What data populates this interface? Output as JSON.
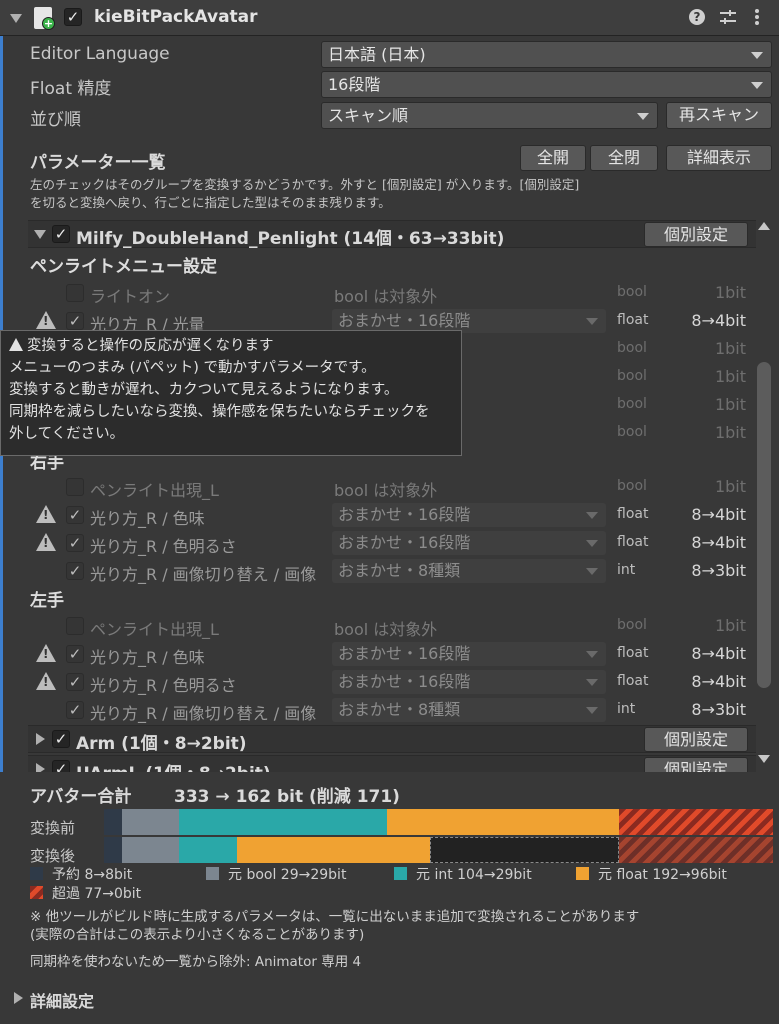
{
  "header": {
    "title": "kieBitPackAvatar",
    "enabled": true
  },
  "settings": {
    "editor_language_label": "Editor Language",
    "editor_language_value": "日本語 (日本)",
    "float_precision_label": "Float 精度",
    "float_precision_value": "16段階",
    "sort_order_label": "並び順",
    "sort_order_value": "スキャン順",
    "rescan_button": "再スキャン"
  },
  "param_list": {
    "title": "パラメーター一覧",
    "expand_all": "全開",
    "collapse_all": "全閉",
    "details_button": "詳細表示",
    "help_line1": "左のチェックはそのグループを変換するかどうかです。外すと [個別設定] が入ります。[個別設定]",
    "help_line2": "を切ると変換へ戻り、行ごとに指定した型はそのまま残ります。"
  },
  "groups": [
    {
      "title": "Milfy_DoubleHand_Penlight  (14個・63→33bit)",
      "button": "個別設定",
      "subsections": [
        {
          "title": "ペンライトメニュー設定",
          "rows": [
            {
              "name": "ライトオン",
              "mode": "bool は対象外",
              "type": "bool",
              "bits": "1bit",
              "checked": false,
              "warn": false,
              "excluded": true
            },
            {
              "name": "光り方_R / 光量",
              "mode": "おまかせ・16段階",
              "type": "float",
              "bits": "8→4bit",
              "checked": true,
              "warn": true,
              "excluded": false
            },
            {
              "name": "",
              "mode": "",
              "type": "bool",
              "bits": "1bit",
              "checked": false,
              "warn": false,
              "excluded": true
            },
            {
              "name": "",
              "mode": "",
              "type": "bool",
              "bits": "1bit",
              "checked": false,
              "warn": false,
              "excluded": true
            },
            {
              "name": "",
              "mode": "",
              "type": "bool",
              "bits": "1bit",
              "checked": false,
              "warn": false,
              "excluded": true
            },
            {
              "name": "",
              "mode": "",
              "type": "bool",
              "bits": "1bit",
              "checked": false,
              "warn": false,
              "excluded": true
            }
          ]
        },
        {
          "title": "右手",
          "rows": [
            {
              "name": "ペンライト出現_L",
              "mode": "bool は対象外",
              "type": "bool",
              "bits": "1bit",
              "checked": false,
              "warn": false,
              "excluded": true
            },
            {
              "name": "光り方_R / 色味",
              "mode": "おまかせ・16段階",
              "type": "float",
              "bits": "8→4bit",
              "checked": true,
              "warn": true,
              "excluded": false
            },
            {
              "name": "光り方_R / 色明るさ",
              "mode": "おまかせ・16段階",
              "type": "float",
              "bits": "8→4bit",
              "checked": true,
              "warn": true,
              "excluded": false
            },
            {
              "name": "光り方_R / 画像切り替え / 画像",
              "mode": "おまかせ・8種類",
              "type": "int",
              "bits": "8→3bit",
              "checked": true,
              "warn": false,
              "excluded": false
            }
          ]
        },
        {
          "title": "左手",
          "rows": [
            {
              "name": "ペンライト出現_L",
              "mode": "bool は対象外",
              "type": "bool",
              "bits": "1bit",
              "checked": false,
              "warn": false,
              "excluded": true
            },
            {
              "name": "光り方_R / 色味",
              "mode": "おまかせ・16段階",
              "type": "float",
              "bits": "8→4bit",
              "checked": true,
              "warn": true,
              "excluded": false
            },
            {
              "name": "光り方_R / 色明るさ",
              "mode": "おまかせ・16段階",
              "type": "float",
              "bits": "8→4bit",
              "checked": true,
              "warn": true,
              "excluded": false
            },
            {
              "name": "光り方_R / 画像切り替え / 画像",
              "mode": "おまかせ・8種類",
              "type": "int",
              "bits": "8→3bit",
              "checked": true,
              "warn": false,
              "excluded": false
            }
          ]
        }
      ]
    },
    {
      "title": "Arm  (1個・8→2bit)",
      "button": "個別設定"
    },
    {
      "title": "UArmL  (1個・8→2bit)",
      "button": "個別設定"
    }
  ],
  "tooltip": {
    "line1": "変換すると操作の反応が遅くなります",
    "line2": "メニューのつまみ (パペット) で動かすパラメータです。",
    "line3": "変換すると動きが遅れ、カクついて見えるようになります。",
    "line4": "同期枠を減らしたいなら変換、操作感を保ちたいならチェックを",
    "line5": "外してください。"
  },
  "summary": {
    "title": "アバター合計",
    "total": "333 → 162 bit  (削減 171)",
    "before_label": "変換前",
    "after_label": "変換後",
    "legend": [
      {
        "label": "予約 8→8bit",
        "color": "#2f3a48"
      },
      {
        "label": "元 bool 29→29bit",
        "color": "#7c8690"
      },
      {
        "label": "元 int 104→29bit",
        "color": "#2aa8a8"
      },
      {
        "label": "元 float 192→96bit",
        "color": "#f0a232"
      },
      {
        "label": "超過 77→0bit",
        "color": "#d2452a"
      }
    ],
    "note1": "※ 他ツールがビルド時に生成するパラメータは、一覧に出ないまま追加で変換されることがあります",
    "note2": "(実際の合計はこの表示より小さくなることがあります)",
    "note3": "同期枠を使わないため一覧から除外: Animator 専用 4",
    "advanced": "詳細設定"
  },
  "colors": {
    "reserved": "#2f3a48",
    "bool": "#7c8690",
    "int": "#2aa8a8",
    "float": "#f0a232",
    "over": "#d2452a",
    "accent": "#3d7fcf"
  }
}
